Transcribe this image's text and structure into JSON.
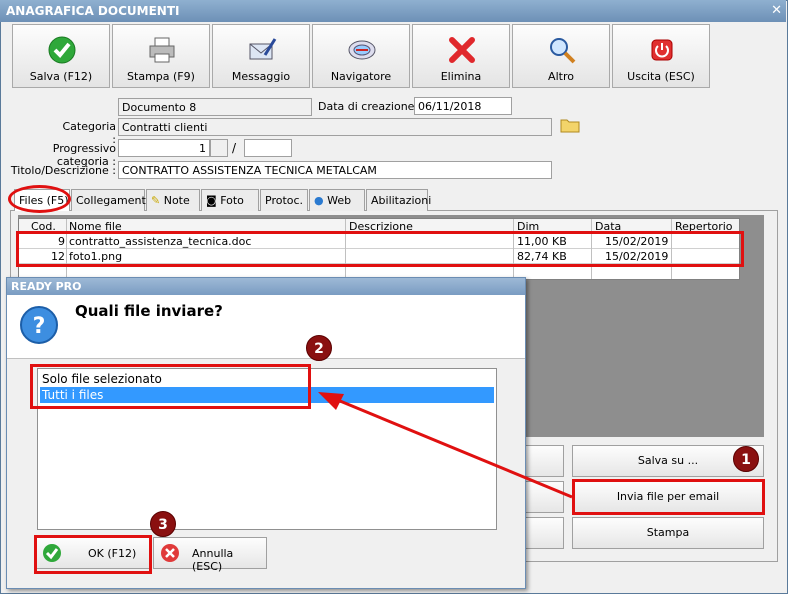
{
  "window": {
    "title": "ANAGRAFICA DOCUMENTI",
    "close": "✕"
  },
  "toolbar": {
    "save": "Salva (F12)",
    "print": "Stampa (F9)",
    "message": "Messaggio",
    "navigator": "Navigatore",
    "delete": "Elimina",
    "other": "Altro",
    "exit": "Uscita (ESC)"
  },
  "form": {
    "document_value": "Documento 8",
    "created_label": "Data di creazione :",
    "created_value": "06/11/2018",
    "category_label": "Categoria :",
    "category_value": "Contratti clienti",
    "progressive_label": "Progressivo categoria :",
    "progressive_value": "1",
    "progressive_sep": "/",
    "title_label": "Titolo/Descrizione :",
    "title_value": "CONTRATTO ASSISTENZA TECNICA METALCAM"
  },
  "tabs": [
    "Files (F5)",
    "Collegamenti",
    "Note",
    "Foto",
    "Protoc.",
    "Web",
    "Abilitazioni"
  ],
  "files_table": {
    "columns": [
      "Cod.",
      "Nome file",
      "Descrizione",
      "Dim",
      "Data",
      "Repertorio"
    ],
    "rows": [
      {
        "cod": "9",
        "name": "contratto_assistenza_tecnica.doc",
        "desc": "",
        "dim": "11,00 KB",
        "date": "15/02/2019",
        "rep": ""
      },
      {
        "cod": "12",
        "name": "foto1.png",
        "desc": "",
        "dim": "82,74 KB",
        "date": "15/02/2019",
        "rep": ""
      }
    ]
  },
  "right_buttons": {
    "save_to": "Salva su ...",
    "send_email": "Invia file per email",
    "print": "Stampa"
  },
  "dialog": {
    "title": "READY PRO",
    "question": "Quali file inviare?",
    "options": [
      "Solo file selezionato",
      "Tutti i files"
    ],
    "selected_index": 1,
    "ok": "OK (F12)",
    "cancel": "Annulla (ESC)"
  },
  "annotations": {
    "badge1": "1",
    "badge2": "2",
    "badge3": "3"
  },
  "colors": {
    "highlight_red": "#e01010",
    "badge": "#8a1010",
    "selection": "#3399ff"
  }
}
